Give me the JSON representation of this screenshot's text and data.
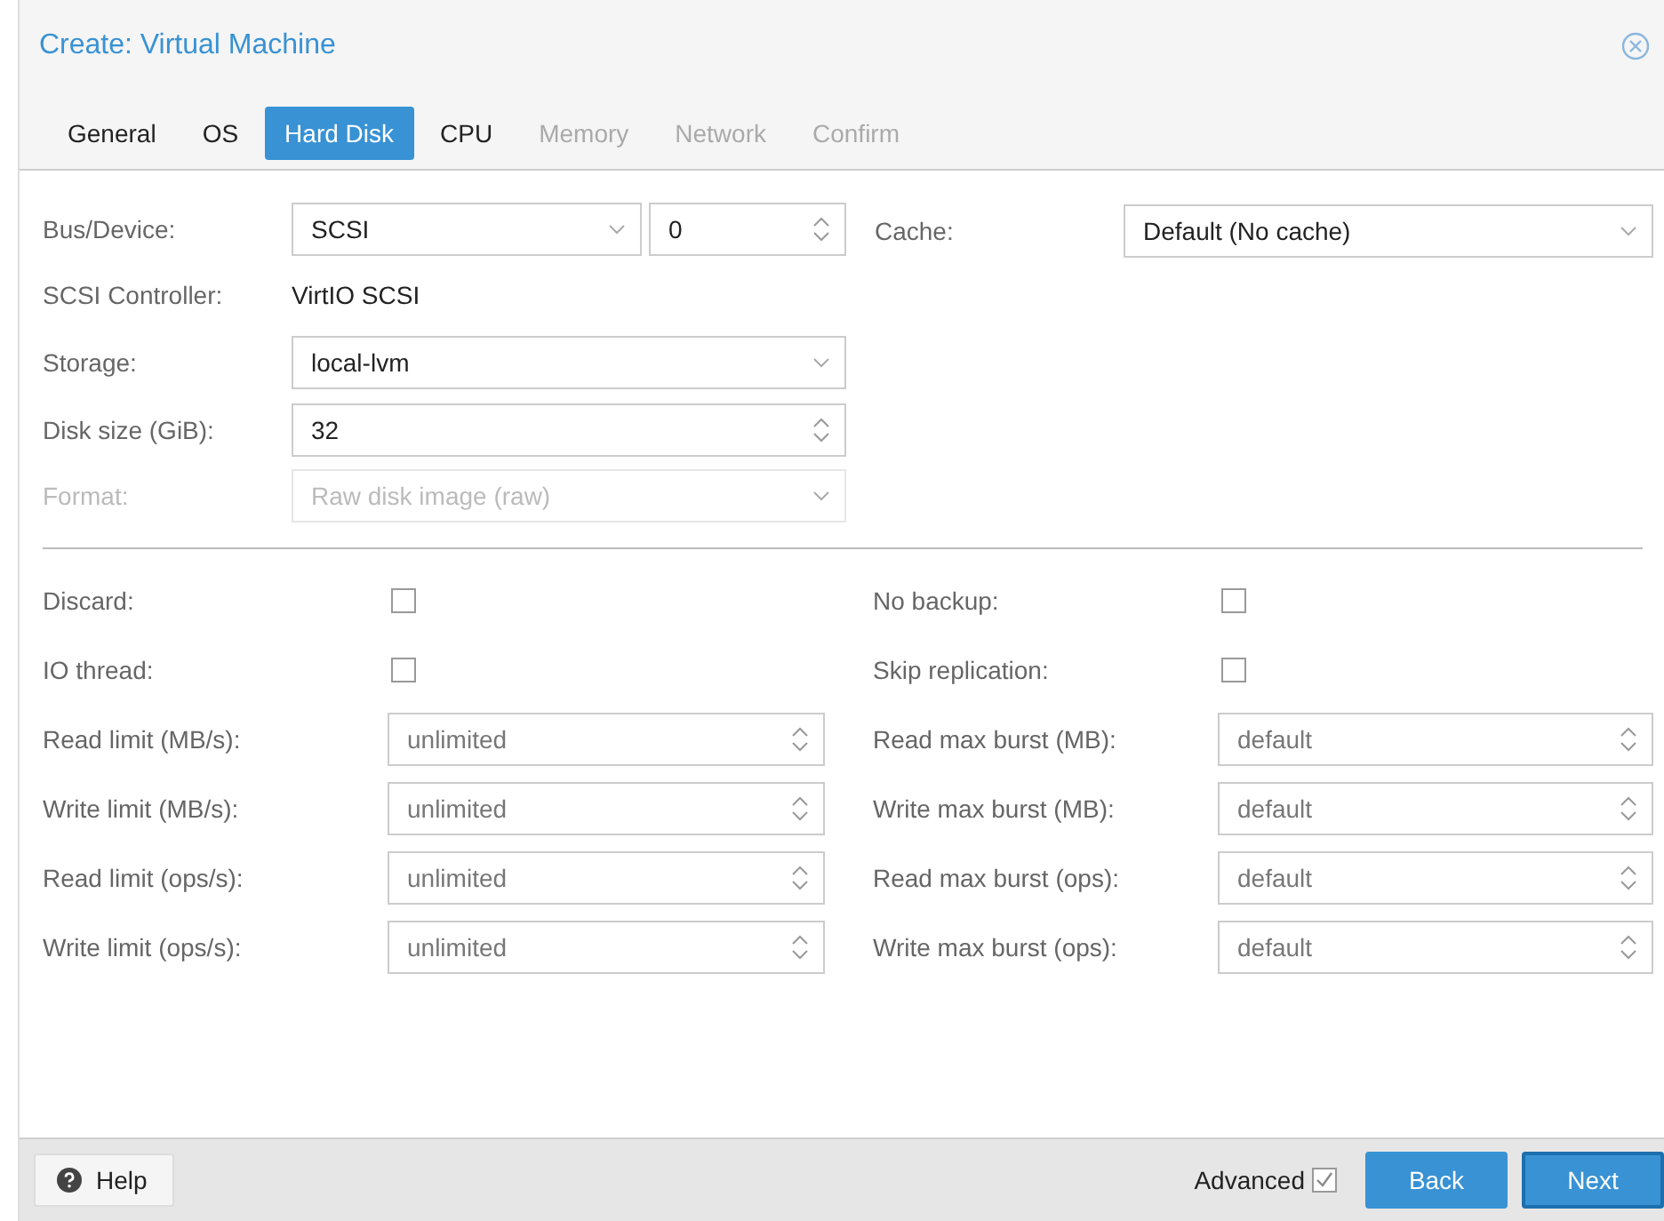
{
  "window": {
    "title": "Create: Virtual Machine"
  },
  "tabs": [
    {
      "label": "General",
      "selected": false,
      "disabled": false
    },
    {
      "label": "OS",
      "selected": false,
      "disabled": false
    },
    {
      "label": "Hard Disk",
      "selected": true,
      "disabled": false
    },
    {
      "label": "CPU",
      "selected": false,
      "disabled": false
    },
    {
      "label": "Memory",
      "selected": false,
      "disabled": true
    },
    {
      "label": "Network",
      "selected": false,
      "disabled": true
    },
    {
      "label": "Confirm",
      "selected": false,
      "disabled": true
    }
  ],
  "top_left": [
    {
      "kind": "combo",
      "label": "Bus/Device:",
      "value": "SCSI",
      "value2": "0",
      "disabled": false
    },
    {
      "kind": "text",
      "label": "SCSI Controller:",
      "value": "VirtIO SCSI",
      "disabled": false
    },
    {
      "kind": "select",
      "label": "Storage:",
      "value": "local-lvm",
      "disabled": false
    },
    {
      "kind": "spin",
      "label": "Disk size (GiB):",
      "value": "32",
      "disabled": false
    },
    {
      "kind": "select",
      "label": "Format:",
      "value": "Raw disk image (raw)",
      "disabled": true
    }
  ],
  "top_right": [
    {
      "kind": "select",
      "label": "Cache:",
      "value": "Default (No cache)",
      "disabled": false
    }
  ],
  "advanced_left": [
    {
      "kind": "check",
      "label": "Discard:",
      "checked": false
    },
    {
      "kind": "check",
      "label": "IO thread:",
      "checked": false
    },
    {
      "kind": "spin",
      "label": "Read limit (MB/s):",
      "placeholder": "unlimited"
    },
    {
      "kind": "spin",
      "label": "Write limit (MB/s):",
      "placeholder": "unlimited"
    },
    {
      "kind": "spin",
      "label": "Read limit (ops/s):",
      "placeholder": "unlimited"
    },
    {
      "kind": "spin",
      "label": "Write limit (ops/s):",
      "placeholder": "unlimited"
    }
  ],
  "advanced_right": [
    {
      "kind": "check",
      "label": "No backup:",
      "checked": false
    },
    {
      "kind": "check",
      "label": "Skip replication:",
      "checked": false
    },
    {
      "kind": "spin",
      "label": "Read max burst (MB):",
      "placeholder": "default"
    },
    {
      "kind": "spin",
      "label": "Write max burst (MB):",
      "placeholder": "default"
    },
    {
      "kind": "spin",
      "label": "Read max burst (ops):",
      "placeholder": "default"
    },
    {
      "kind": "spin",
      "label": "Write max burst (ops):",
      "placeholder": "default"
    }
  ],
  "footer": {
    "help": "Help",
    "advanced": {
      "label": "Advanced",
      "checked": true
    },
    "buttons": [
      {
        "label": "Back",
        "kind": "normal"
      },
      {
        "label": "Next",
        "kind": "focused"
      }
    ]
  }
}
